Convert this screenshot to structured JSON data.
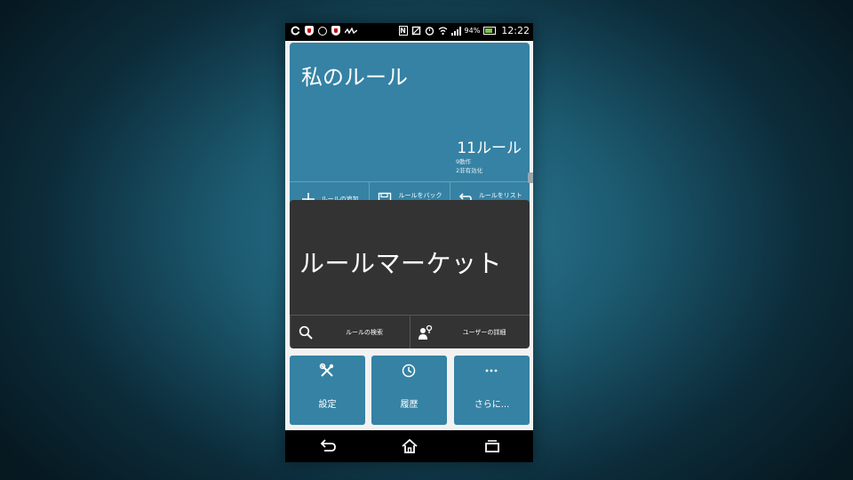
{
  "status_bar": {
    "left_icons": [
      "gear-icon",
      "shield-icon",
      "sync-circle-icon",
      "shield-icon",
      "walkman-icon"
    ],
    "right_icons": [
      "nfc-icon",
      "rotation-icon",
      "alarm-icon",
      "wifi-icon",
      "signal-icon"
    ],
    "battery": "94%",
    "time": "12:22"
  },
  "my_rules": {
    "title": "私のルール",
    "count": "11ルール",
    "detail1": "9動作",
    "detail2": "2非有効化",
    "actions": [
      {
        "icon": "plus-icon",
        "label": "ルールの追加"
      },
      {
        "icon": "save-icon",
        "label": "ルールをバックアップ"
      },
      {
        "icon": "undo-icon",
        "label": "ルールをリストア"
      }
    ]
  },
  "market": {
    "title": "ルールマーケット",
    "actions": [
      {
        "icon": "search-icon",
        "label": "ルールの検索"
      },
      {
        "icon": "user-location-icon",
        "label": "ユーザーの詳細"
      }
    ]
  },
  "tiles": [
    {
      "icon": "tools-icon",
      "label": "設定"
    },
    {
      "icon": "clock-icon",
      "label": "履歴"
    },
    {
      "icon": "more-icon",
      "label": "さらに..."
    }
  ],
  "nav": [
    "back-icon",
    "home-icon",
    "recent-apps-icon"
  ],
  "colors": {
    "tile_blue": "#3582a4",
    "tile_dark": "#333333"
  }
}
